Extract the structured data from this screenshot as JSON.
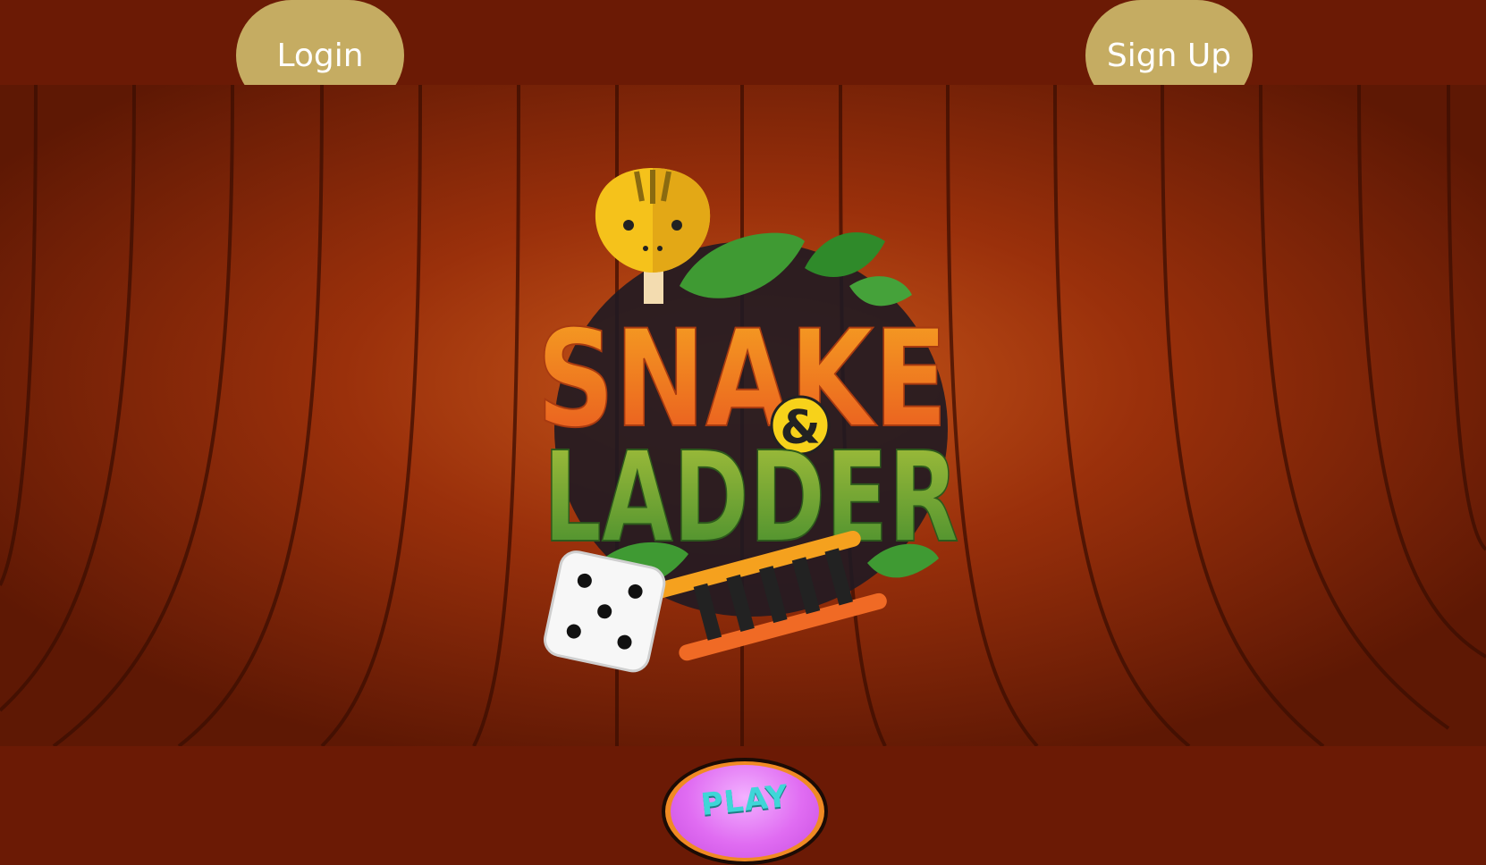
{
  "header": {
    "login_label": "Login",
    "signup_label": "Sign Up"
  },
  "logo": {
    "line1": "SNAKE",
    "ampersand": "&",
    "line2": "LADDER"
  },
  "play_button": {
    "label": "PLAY"
  },
  "colors": {
    "background": "#6b1a05",
    "wood": "#8a2808",
    "button": "#c5ac62",
    "snake_text": "#f07a20",
    "ladder_text": "#6aa33a",
    "play_fill": "#e06cf2",
    "play_text": "#3fd6d8"
  }
}
